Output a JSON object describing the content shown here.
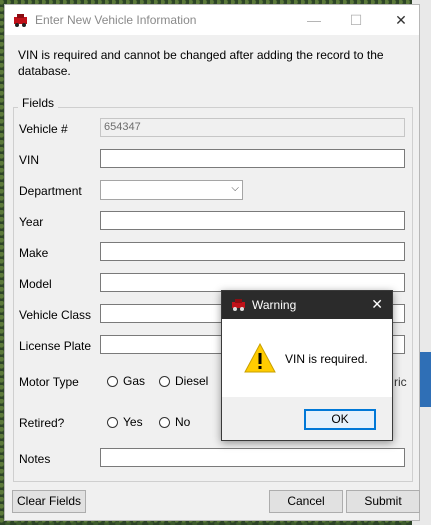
{
  "window": {
    "title": "Enter New Vehicle Information",
    "note": "VIN is required and cannot be changed after adding the record to the database."
  },
  "fields_group": {
    "legend": "Fields",
    "vehicle_no": {
      "label": "Vehicle #",
      "value": "654347"
    },
    "vin": {
      "label": "VIN",
      "value": ""
    },
    "department": {
      "label": "Department",
      "value": ""
    },
    "year": {
      "label": "Year",
      "value": ""
    },
    "make": {
      "label": "Make",
      "value": ""
    },
    "model": {
      "label": "Model",
      "value": ""
    },
    "vehicle_class": {
      "label": "Vehicle Class",
      "value": ""
    },
    "license_plate": {
      "label": "License Plate",
      "value": ""
    },
    "motor_type": {
      "label": "Motor Type",
      "options": [
        "Gas",
        "Diesel"
      ],
      "partial_option_text": "ric"
    },
    "retired": {
      "label": "Retired?",
      "options": [
        "Yes",
        "No"
      ]
    },
    "notes": {
      "label": "Notes",
      "value": ""
    }
  },
  "buttons": {
    "clear": "Clear Fields",
    "cancel": "Cancel",
    "submit": "Submit"
  },
  "warning": {
    "title": "Warning",
    "message": "VIN is required.",
    "ok": "OK"
  }
}
